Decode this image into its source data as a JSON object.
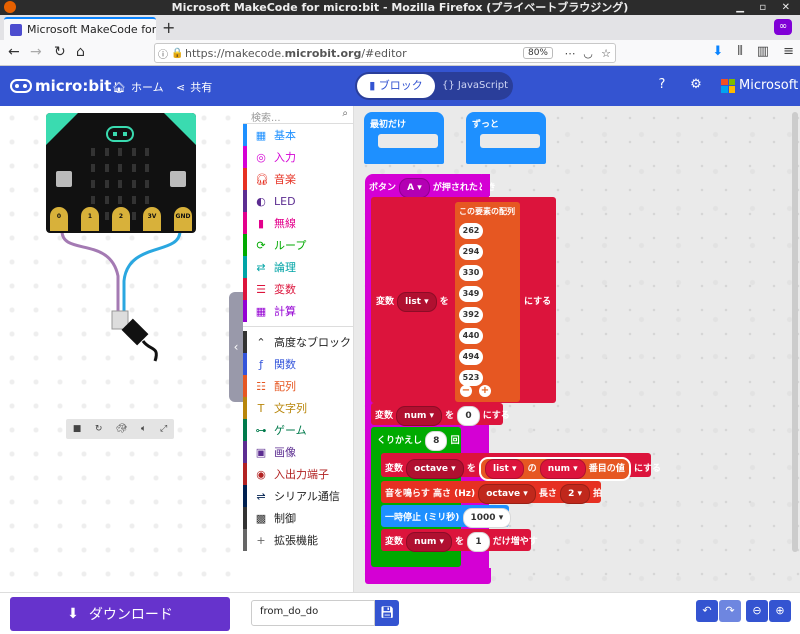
{
  "window": {
    "title": "Microsoft MakeCode for micro:bit - Mozilla Firefox (プライベートブラウジング)"
  },
  "browser": {
    "tab_title": "Microsoft MakeCode for m",
    "url_prefix": "https://makecode.",
    "url_host": "microbit.org",
    "url_suffix": "/#editor",
    "zoom": "80%"
  },
  "header": {
    "brand": "micro:bit",
    "home_label": "ホーム",
    "share_label": "共有",
    "blocks_label": "ブロック",
    "js_label": "JavaScript",
    "microsoft_label": "Microsoft"
  },
  "simulator": {
    "pins": [
      "0",
      "1",
      "2",
      "3V",
      "GND"
    ]
  },
  "toolbox": {
    "search_placeholder": "検索...",
    "categories": [
      {
        "label": "基本",
        "color": "#1e90ff",
        "icon": "grid-icon"
      },
      {
        "label": "入力",
        "color": "#d400d4",
        "icon": "target-icon"
      },
      {
        "label": "音楽",
        "color": "#e63022",
        "icon": "headphones-icon"
      },
      {
        "label": "LED",
        "color": "#5c2d91",
        "icon": "toggle-icon"
      },
      {
        "label": "無線",
        "color": "#e3008c",
        "icon": "signal-icon"
      },
      {
        "label": "ループ",
        "color": "#00aa00",
        "icon": "refresh-icon"
      },
      {
        "label": "論理",
        "color": "#00a4a6",
        "icon": "shuffle-icon"
      },
      {
        "label": "変数",
        "color": "#dc143c",
        "icon": "lines-icon"
      },
      {
        "label": "計算",
        "color": "#9400d3",
        "icon": "calculator-icon"
      }
    ],
    "advanced_label": "高度なブロック",
    "advanced_categories": [
      {
        "label": "関数",
        "color": "#3455db",
        "icon": "function-icon"
      },
      {
        "label": "配列",
        "color": "#e65722",
        "icon": "list-icon"
      },
      {
        "label": "文字列",
        "color": "#b8860b",
        "icon": "text-icon"
      },
      {
        "label": "ゲーム",
        "color": "#007a4b",
        "icon": "gamepad-icon"
      },
      {
        "label": "画像",
        "color": "#5c2d91",
        "icon": "image-icon"
      },
      {
        "label": "入出力端子",
        "color": "#b22222",
        "icon": "pin-icon"
      },
      {
        "label": "シリアル通信",
        "color": "#002050",
        "icon": "usb-icon"
      },
      {
        "label": "制御",
        "color": "#333333",
        "icon": "chip-icon"
      },
      {
        "label": "拡張機能",
        "color": "#666666",
        "icon": "plus-icon"
      }
    ]
  },
  "workspace": {
    "on_start": "最初だけ",
    "forever": "ずっと",
    "on_button": {
      "prefix": "ボタン",
      "button": "A",
      "suffix": "が押されたとき"
    },
    "set_list": {
      "prefix": "変数",
      "var": "list",
      "to": "を",
      "suffix": "にする"
    },
    "array_label": "この要素の配列",
    "array_values": [
      "262",
      "294",
      "330",
      "349",
      "392",
      "440",
      "494",
      "523"
    ],
    "set_num": {
      "prefix": "変数",
      "var": "num",
      "to": "を",
      "value": "0",
      "suffix": "にする"
    },
    "repeat": {
      "prefix": "くりかえし",
      "count": "8",
      "suffix": "回"
    },
    "set_octave": {
      "prefix": "変数",
      "var": "octave",
      "to": "を",
      "list": "list",
      "of": "の",
      "index": "num",
      "suffix": "番目の値",
      "suffix2": "にする"
    },
    "play_tone": {
      "prefix": "音を鳴らす 高さ (Hz)",
      "freq": "octave",
      "len_label": "長さ",
      "beats": "2",
      "beats_suffix": "拍"
    },
    "pause": {
      "prefix": "一時停止 (ミリ秒)",
      "value": "1000"
    },
    "change_num": {
      "prefix": "変数",
      "var": "num",
      "to": "を",
      "value": "1",
      "suffix": "だけ増やす"
    }
  },
  "footer": {
    "download_label": "ダウンロード",
    "filename": "from_do_do"
  }
}
